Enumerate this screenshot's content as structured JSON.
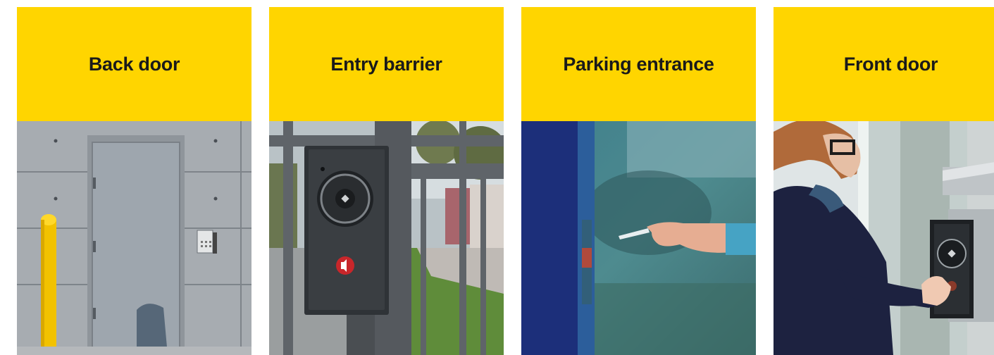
{
  "brand": {
    "accent": "#ffd500",
    "text": "#1a1a1a"
  },
  "cards": [
    {
      "title": "Back door",
      "image": "grey-steel-back-door-with-yellow-bollard"
    },
    {
      "title": "Entry barrier",
      "image": "intercom-mounted-on-gate-post"
    },
    {
      "title": "Parking entrance",
      "image": "hand-holding-access-card-to-reader"
    },
    {
      "title": "Front door",
      "image": "woman-pressing-intercom-button"
    }
  ]
}
